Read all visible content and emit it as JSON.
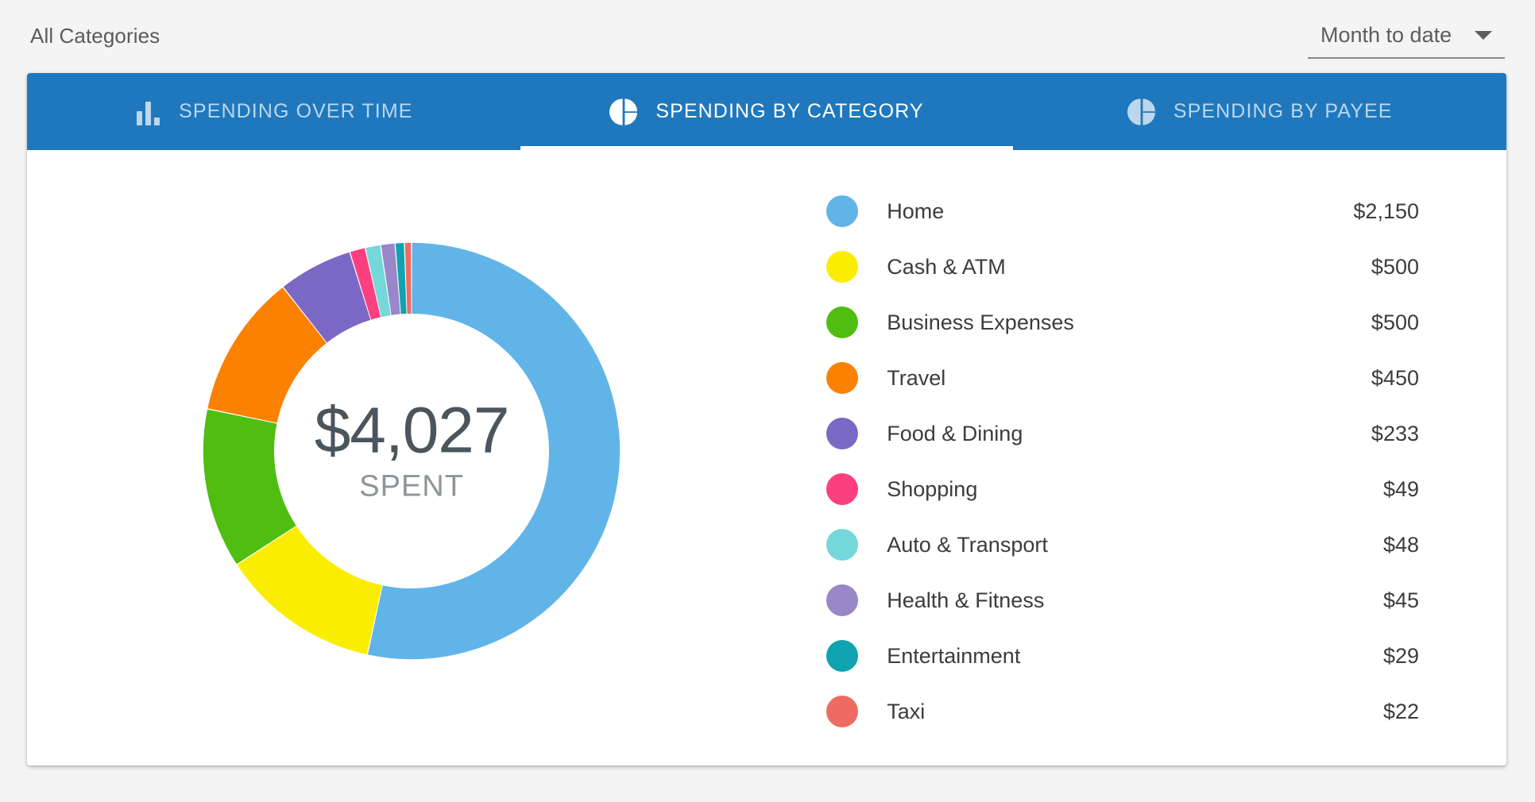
{
  "header": {
    "title": "All Categories",
    "period": {
      "label": "Month to date",
      "icon": "chevron-down-icon"
    }
  },
  "tabs": [
    {
      "label": "SPENDING OVER TIME",
      "icon": "bar-chart-icon",
      "active": false
    },
    {
      "label": "SPENDING BY CATEGORY",
      "icon": "pie-chart-icon",
      "active": true
    },
    {
      "label": "SPENDING BY PAYEE",
      "icon": "pie-chart-icon",
      "active": false
    }
  ],
  "donut": {
    "center_amount": "$4,027",
    "center_caption": "SPENT"
  },
  "chart_data": {
    "type": "pie",
    "title": "Spending by Category",
    "subtitle": "Month to date",
    "center_value": 4027,
    "center_label": "SPENT",
    "units": "USD",
    "start_angle": 0,
    "direction": "clockwise",
    "inner_radius_ratio": 0.66,
    "legend_position": "right",
    "categories": [
      "Home",
      "Cash & ATM",
      "Business Expenses",
      "Travel",
      "Food & Dining",
      "Shopping",
      "Auto & Transport",
      "Health & Fitness",
      "Entertainment",
      "Taxi"
    ],
    "values": [
      2150,
      500,
      500,
      450,
      233,
      49,
      48,
      45,
      29,
      22
    ],
    "labels": [
      "$2,150",
      "$500",
      "$500",
      "$450",
      "$233",
      "$49",
      "$48",
      "$45",
      "$29",
      "$22"
    ],
    "colors": [
      "#61b4e8",
      "#fbed00",
      "#4fbe10",
      "#fb8100",
      "#7b68c4",
      "#fb3f7f",
      "#74d7da",
      "#9987c9",
      "#0fa3b1",
      "#ef6b62"
    ]
  },
  "legend": [
    {
      "name": "Home",
      "amount": "$2,150",
      "color": "#61b4e8"
    },
    {
      "name": "Cash & ATM",
      "amount": "$500",
      "color": "#fbed00"
    },
    {
      "name": "Business Expenses",
      "amount": "$500",
      "color": "#4fbe10"
    },
    {
      "name": "Travel",
      "amount": "$450",
      "color": "#fb8100"
    },
    {
      "name": "Food & Dining",
      "amount": "$233",
      "color": "#7b68c4"
    },
    {
      "name": "Shopping",
      "amount": "$49",
      "color": "#fb3f7f"
    },
    {
      "name": "Auto & Transport",
      "amount": "$48",
      "color": "#74d7da"
    },
    {
      "name": "Health & Fitness",
      "amount": "$45",
      "color": "#9987c9"
    },
    {
      "name": "Entertainment",
      "amount": "$29",
      "color": "#0fa3b1"
    },
    {
      "name": "Taxi",
      "amount": "$22",
      "color": "#ef6b62"
    }
  ],
  "theme": {
    "accent": "#1f78bd",
    "page_bg": "#f4f4f4",
    "card_bg": "#ffffff",
    "tab_inactive": "#bcd6ec"
  }
}
